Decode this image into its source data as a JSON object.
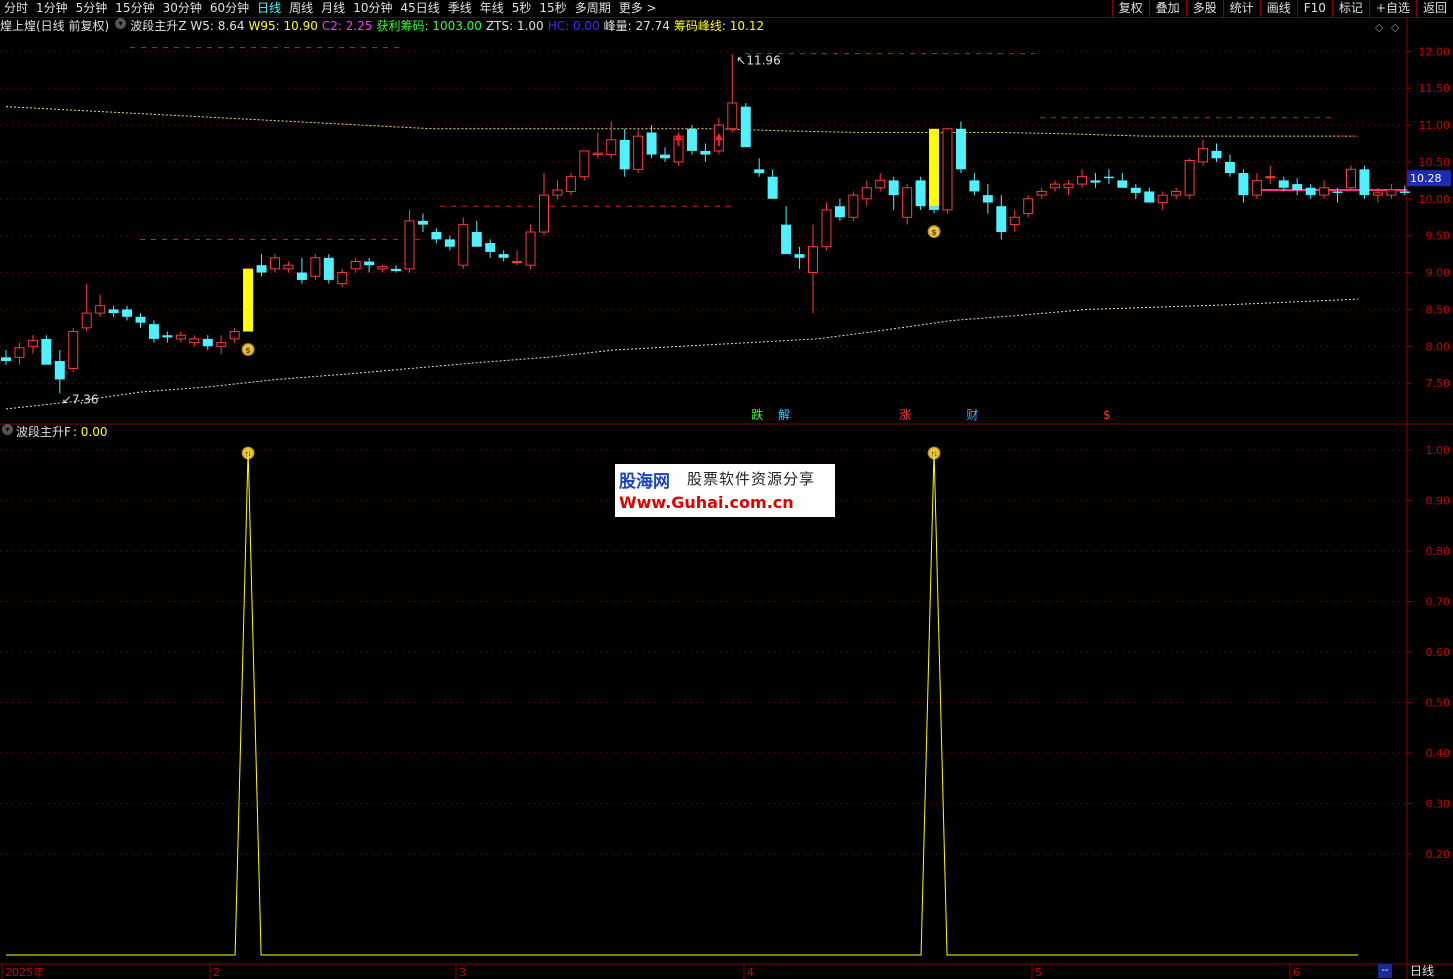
{
  "toolbar": {
    "periods": [
      "分时",
      "1分钟",
      "5分钟",
      "15分钟",
      "30分钟",
      "60分钟",
      "日线",
      "周线",
      "月线",
      "10分钟",
      "45日线",
      "季线",
      "年线",
      "5秒",
      "15秒",
      "多周期",
      "更多 >"
    ],
    "active_period": "日线",
    "right_tools": [
      "复权",
      "叠加",
      "多股",
      "统计",
      "画线",
      "F10",
      "标记",
      "+自选",
      "返回"
    ]
  },
  "main_info": {
    "stock": "煌上煌(日线 前复权)",
    "indicator": "波段主升Z",
    "items": [
      {
        "label": "W5: 8.64",
        "color": "#e0e0e0"
      },
      {
        "label": "W95: 10.90",
        "color": "#ffff00"
      },
      {
        "label": "C2: 2.25",
        "color": "#ff33ff"
      },
      {
        "label": "获利筹码: 1003.00",
        "color": "#33ff33"
      },
      {
        "label": "ZTS: 1.00",
        "color": "#e0e0e0"
      },
      {
        "label": "HC: 0.00",
        "color": "#3333ff"
      },
      {
        "label": "峰量: 27.74",
        "color": "#e0e0e0"
      },
      {
        "label": "筹码峰线: 10.12",
        "color": "#ffff00"
      }
    ]
  },
  "sub_info": {
    "indicator": "波段主升F",
    "value": ": 0.00"
  },
  "watermark": {
    "line1": "股海网",
    "line2": "股票软件资源分享",
    "line3": "Www.Guhai.com.cn"
  },
  "price_labels": {
    "high": "11.96",
    "low": "7.36",
    "current": "10.28"
  },
  "signals": [
    {
      "text": "跌",
      "color": "#33ff33",
      "idx": 56
    },
    {
      "text": "解",
      "color": "#44ccff",
      "idx": 58
    },
    {
      "text": "涨",
      "color": "#ff3333",
      "idx": 67
    },
    {
      "text": "财",
      "color": "#44aaff",
      "idx": 72
    },
    {
      "text": "$",
      "color": "#ff3333",
      "idx": 82
    }
  ],
  "month_labels": [
    "2025年",
    "2",
    "3",
    "4",
    "5",
    "6"
  ],
  "bottom_right": "日线",
  "bottom_dash": "--",
  "chart_data": {
    "type": "candlestick",
    "y_axis_main": {
      "ticks": [
        7.5,
        8.0,
        8.5,
        9.0,
        9.5,
        10.0,
        10.5,
        11.0,
        11.5,
        12.0
      ],
      "range": [
        7.0,
        12.1
      ]
    },
    "y_axis_sub": {
      "ticks": [
        0.2,
        0.3,
        0.4,
        0.5,
        0.6,
        0.7,
        0.8,
        0.9,
        1.0
      ],
      "range": [
        0.0,
        1.02
      ]
    },
    "candles": [
      [
        7.85,
        7.95,
        7.75,
        7.8
      ],
      [
        7.85,
        8.05,
        7.75,
        7.98
      ],
      [
        8.0,
        8.15,
        7.9,
        8.08
      ],
      [
        8.1,
        8.15,
        7.85,
        7.75
      ],
      [
        7.8,
        7.95,
        7.36,
        7.55
      ],
      [
        7.7,
        8.25,
        7.65,
        8.2
      ],
      [
        8.25,
        8.85,
        8.2,
        8.45
      ],
      [
        8.45,
        8.7,
        8.4,
        8.55
      ],
      [
        8.5,
        8.55,
        8.4,
        8.45
      ],
      [
        8.5,
        8.55,
        8.35,
        8.4
      ],
      [
        8.4,
        8.45,
        8.25,
        8.32
      ],
      [
        8.3,
        8.35,
        8.05,
        8.1
      ],
      [
        8.15,
        8.2,
        8.05,
        8.12
      ],
      [
        8.1,
        8.2,
        8.05,
        8.15
      ],
      [
        8.05,
        8.15,
        8.0,
        8.1
      ],
      [
        8.1,
        8.15,
        7.95,
        8.0
      ],
      [
        8.0,
        8.15,
        7.9,
        8.05
      ],
      [
        8.1,
        8.25,
        8.05,
        8.2
      ],
      [
        8.25,
        9.05,
        8.2,
        9.05
      ],
      [
        9.1,
        9.25,
        8.95,
        9.0
      ],
      [
        9.05,
        9.25,
        9.0,
        9.2
      ],
      [
        9.05,
        9.15,
        9.0,
        9.1
      ],
      [
        9.0,
        9.2,
        8.85,
        8.9
      ],
      [
        8.95,
        9.25,
        8.9,
        9.2
      ],
      [
        9.2,
        9.25,
        8.85,
        8.9
      ],
      [
        8.85,
        9.05,
        8.8,
        9.0
      ],
      [
        9.05,
        9.2,
        9.0,
        9.15
      ],
      [
        9.15,
        9.2,
        9.0,
        9.1
      ],
      [
        9.05,
        9.1,
        9.0,
        9.08
      ],
      [
        9.05,
        9.1,
        9.0,
        9.02
      ],
      [
        9.05,
        9.85,
        9.0,
        9.7
      ],
      [
        9.7,
        9.8,
        9.55,
        9.65
      ],
      [
        9.55,
        9.6,
        9.4,
        9.45
      ],
      [
        9.45,
        9.5,
        9.3,
        9.35
      ],
      [
        9.1,
        9.75,
        9.05,
        9.65
      ],
      [
        9.55,
        9.7,
        9.4,
        9.35
      ],
      [
        9.4,
        9.45,
        9.2,
        9.28
      ],
      [
        9.25,
        9.3,
        9.15,
        9.2
      ],
      [
        9.15,
        9.3,
        9.1,
        9.15
      ],
      [
        9.1,
        9.65,
        9.05,
        9.55
      ],
      [
        9.55,
        10.35,
        9.5,
        10.05
      ],
      [
        10.05,
        10.25,
        10.0,
        10.12
      ],
      [
        10.1,
        10.35,
        10.05,
        10.3
      ],
      [
        10.3,
        10.55,
        10.25,
        10.65
      ],
      [
        10.6,
        10.9,
        10.55,
        10.62
      ],
      [
        10.6,
        11.05,
        10.55,
        10.8
      ],
      [
        10.8,
        10.95,
        10.3,
        10.4
      ],
      [
        10.4,
        10.95,
        10.35,
        10.85
      ],
      [
        10.9,
        11.0,
        10.55,
        10.6
      ],
      [
        10.6,
        10.7,
        10.5,
        10.55
      ],
      [
        10.5,
        10.9,
        10.45,
        10.85
      ],
      [
        10.95,
        11.0,
        10.6,
        10.65
      ],
      [
        10.65,
        10.75,
        10.5,
        10.6
      ],
      [
        10.65,
        11.1,
        10.6,
        11.0
      ],
      [
        10.95,
        11.96,
        10.9,
        11.3
      ],
      [
        11.25,
        11.3,
        10.9,
        10.7
      ],
      [
        10.4,
        10.55,
        10.3,
        10.35
      ],
      [
        10.3,
        10.4,
        10.05,
        10.0
      ],
      [
        9.65,
        9.9,
        9.5,
        9.25
      ],
      [
        9.25,
        9.35,
        9.05,
        9.2
      ],
      [
        9.0,
        9.65,
        8.45,
        9.35
      ],
      [
        9.35,
        9.95,
        9.3,
        9.85
      ],
      [
        9.9,
        10.0,
        9.7,
        9.75
      ],
      [
        9.75,
        10.1,
        9.7,
        10.05
      ],
      [
        10.0,
        10.25,
        9.9,
        10.15
      ],
      [
        10.15,
        10.35,
        10.1,
        10.25
      ],
      [
        10.25,
        10.3,
        9.85,
        10.05
      ],
      [
        9.75,
        10.2,
        9.65,
        10.15
      ],
      [
        10.25,
        10.3,
        9.85,
        9.9
      ],
      [
        9.9,
        10.05,
        9.8,
        9.85
      ],
      [
        9.85,
        10.55,
        9.8,
        10.95
      ],
      [
        10.95,
        11.05,
        10.35,
        10.4
      ],
      [
        10.25,
        10.35,
        10.05,
        10.1
      ],
      [
        10.05,
        10.2,
        9.8,
        9.95
      ],
      [
        9.9,
        10.05,
        9.45,
        9.55
      ],
      [
        9.65,
        9.85,
        9.55,
        9.75
      ],
      [
        9.8,
        10.05,
        9.75,
        10.0
      ],
      [
        10.05,
        10.15,
        10.0,
        10.1
      ],
      [
        10.15,
        10.25,
        10.1,
        10.2
      ],
      [
        10.15,
        10.25,
        10.05,
        10.2
      ],
      [
        10.2,
        10.4,
        10.15,
        10.3
      ],
      [
        10.25,
        10.35,
        10.15,
        10.22
      ],
      [
        10.3,
        10.4,
        10.2,
        10.28
      ],
      [
        10.25,
        10.35,
        10.15,
        10.15
      ],
      [
        10.15,
        10.2,
        10.0,
        10.08
      ],
      [
        10.1,
        10.15,
        9.95,
        9.95
      ],
      [
        9.95,
        10.1,
        9.85,
        10.05
      ],
      [
        10.05,
        10.15,
        10.0,
        10.1
      ],
      [
        10.05,
        10.55,
        10.0,
        10.52
      ],
      [
        10.5,
        10.8,
        10.45,
        10.68
      ],
      [
        10.65,
        10.75,
        10.5,
        10.55
      ],
      [
        10.5,
        10.6,
        10.3,
        10.35
      ],
      [
        10.35,
        10.4,
        9.95,
        10.05
      ],
      [
        10.05,
        10.35,
        10.0,
        10.25
      ],
      [
        10.3,
        10.45,
        10.2,
        10.3
      ],
      [
        10.25,
        10.3,
        10.1,
        10.15
      ],
      [
        10.2,
        10.28,
        10.05,
        10.12
      ],
      [
        10.15,
        10.2,
        10.0,
        10.05
      ],
      [
        10.05,
        10.25,
        10.0,
        10.15
      ],
      [
        10.1,
        10.15,
        9.95,
        10.08
      ],
      [
        10.15,
        10.45,
        10.1,
        10.4
      ],
      [
        10.4,
        10.45,
        10.0,
        10.05
      ],
      [
        10.05,
        10.15,
        9.95,
        10.08
      ],
      [
        10.05,
        10.2,
        10.0,
        10.12
      ],
      [
        10.1,
        10.18,
        10.05,
        10.08
      ]
    ],
    "yellow_bars": [
      {
        "idx": 18,
        "low": 8.2,
        "high": 9.05
      },
      {
        "idx": 69,
        "low": 9.9,
        "high": 10.95
      }
    ],
    "money_signals": [
      18,
      69
    ],
    "sub_series": {
      "name": "波段主升F",
      "peaks": [
        18,
        69
      ]
    },
    "upper_line": [
      11.25,
      11.2,
      11.15,
      11.1,
      11.05,
      11.0,
      10.95,
      10.95,
      10.95,
      10.95,
      10.95,
      10.92,
      10.9,
      10.9,
      10.9,
      10.88,
      10.85,
      10.85,
      10.85,
      10.85
    ],
    "lower_line": [
      7.15,
      7.25,
      7.38,
      7.45,
      7.55,
      7.62,
      7.7,
      7.78,
      7.85,
      7.95,
      8.0,
      8.05,
      8.1,
      8.22,
      8.35,
      8.42,
      8.5,
      8.53,
      8.56,
      8.6,
      8.64
    ],
    "chip_peak_line": 10.12
  }
}
